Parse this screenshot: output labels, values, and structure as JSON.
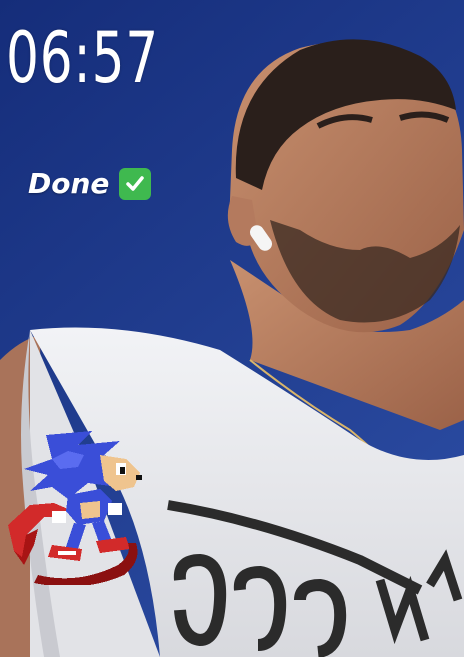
{
  "story": {
    "clock_text": "06:57",
    "caption_text": "Done",
    "caption_emoji": "check-mark-button-icon"
  },
  "stickers": [
    "sonic-running-sprite"
  ],
  "colors": {
    "sky": "#1e3a8c",
    "shirt": "#e8e9ec",
    "skin": "#b87c5e",
    "check_green": "#3fb94f",
    "text": "#ffffff"
  }
}
